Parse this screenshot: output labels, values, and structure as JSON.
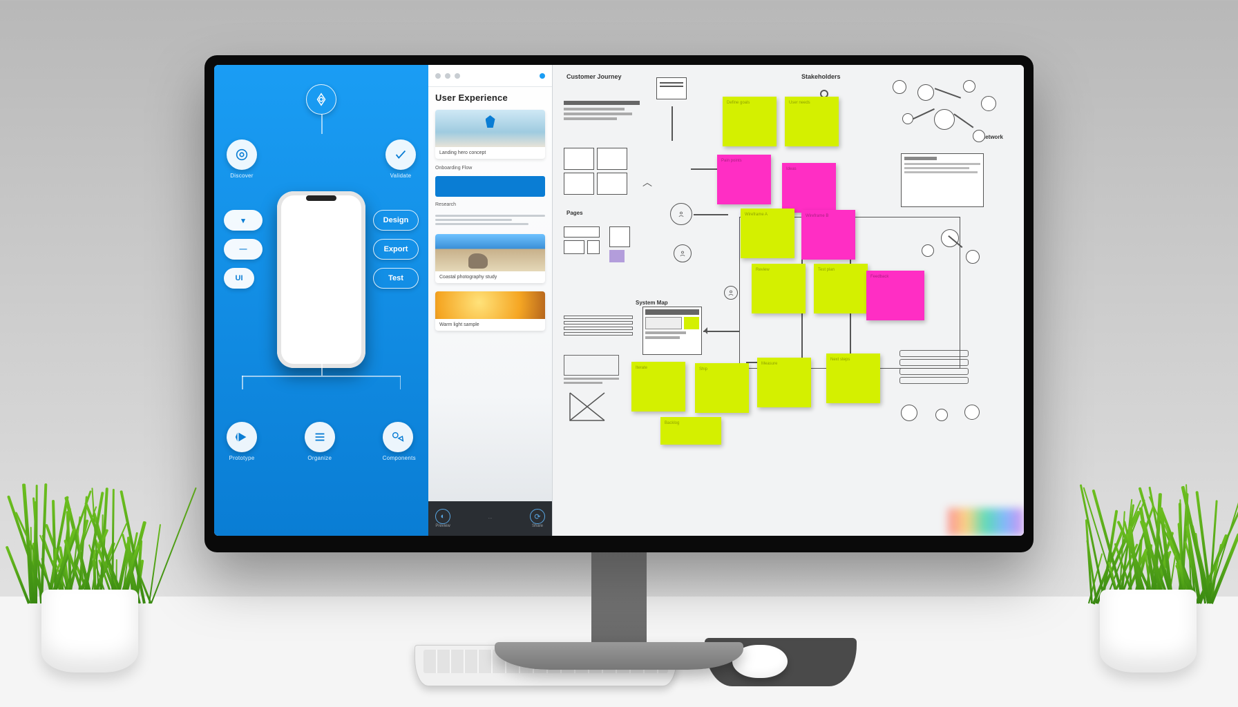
{
  "left_panel": {
    "top_icon": "compass-icon",
    "icons": {
      "target": "Discover",
      "check": "Validate",
      "play": "Prototype",
      "list": "Organize",
      "shapes": "Components"
    },
    "pills": {
      "chev_down": "▾",
      "dash": "—",
      "small": "UI",
      "outline1": "Design",
      "outline2": "Export",
      "outline3": "Test"
    }
  },
  "mid_panel": {
    "title": "User Experience",
    "section1": "Onboarding Flow",
    "section2": "Research",
    "card1_caption": "Landing hero concept",
    "card2_caption": "Coastal photography study",
    "card3_caption": "Warm light sample",
    "bottom_left": "Preview",
    "bottom_right": "Share"
  },
  "whiteboard": {
    "heading_left": "Customer Journey",
    "heading_right": "Stakeholders",
    "heading_right2": "Network",
    "label_pages": "Pages",
    "label_system": "System Map",
    "stickies": [
      {
        "color": "lime",
        "text": "Define goals"
      },
      {
        "color": "lime",
        "text": "User needs"
      },
      {
        "color": "pink",
        "text": "Pain points"
      },
      {
        "color": "pink",
        "text": "Ideas"
      },
      {
        "color": "lime",
        "text": "Wireframe A"
      },
      {
        "color": "pink",
        "text": "Wireframe B"
      },
      {
        "color": "lime",
        "text": "Review"
      },
      {
        "color": "lime",
        "text": "Test plan"
      },
      {
        "color": "pink",
        "text": "Feedback"
      },
      {
        "color": "lime",
        "text": "Iterate"
      },
      {
        "color": "lime",
        "text": "Ship"
      },
      {
        "color": "lime",
        "text": "Measure"
      },
      {
        "color": "lime",
        "text": "Next steps"
      },
      {
        "color": "lime",
        "text": "Backlog"
      }
    ]
  }
}
